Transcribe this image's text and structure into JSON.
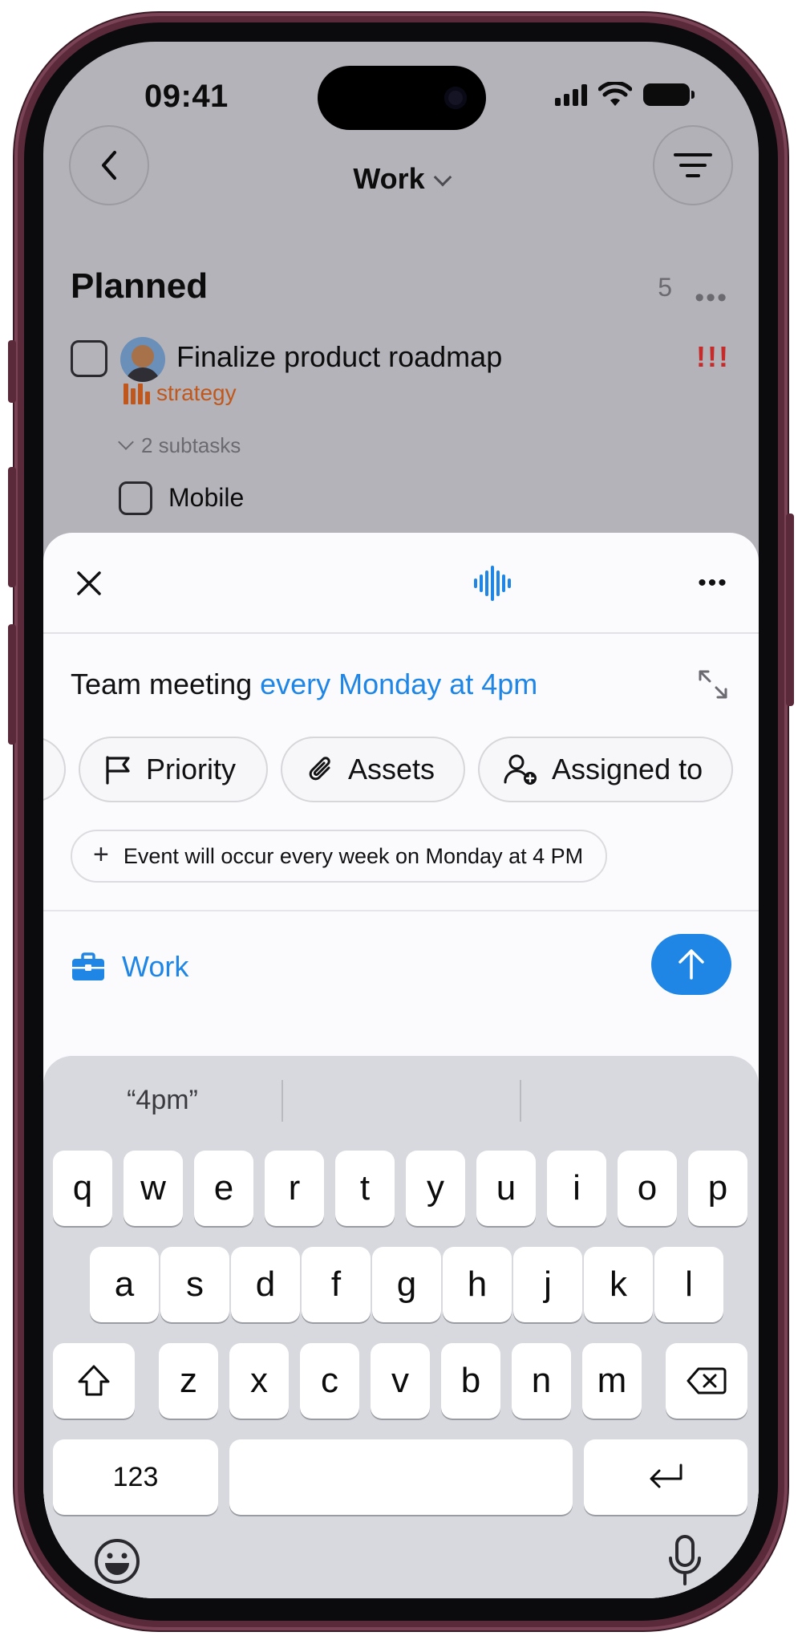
{
  "status_bar": {
    "time": "09:41"
  },
  "nav": {
    "title": "Work"
  },
  "list": {
    "section_title": "Planned",
    "count": "5",
    "task": {
      "title": "Finalize product roadmap",
      "priority": "!!!",
      "tag": "strategy",
      "subtasks_label": "2 subtasks",
      "subtask_title": "Mobile"
    }
  },
  "composer": {
    "text_plain": "Team meeting ",
    "text_highlight": "every Monday at 4pm",
    "chips": [
      {
        "label": "Priority",
        "icon": "flag-icon"
      },
      {
        "label": "Assets",
        "icon": "paperclip-icon"
      },
      {
        "label": "Assigned to",
        "icon": "add-person-icon"
      }
    ],
    "suggestion": "Event will occur every week on Monday at 4 PM",
    "project": "Work"
  },
  "keyboard": {
    "predictions": [
      "“4pm”",
      "",
      ""
    ],
    "rows": [
      [
        "q",
        "w",
        "e",
        "r",
        "t",
        "y",
        "u",
        "i",
        "o",
        "p"
      ],
      [
        "a",
        "s",
        "d",
        "f",
        "g",
        "h",
        "j",
        "k",
        "l"
      ],
      [
        "z",
        "x",
        "c",
        "v",
        "b",
        "n",
        "m"
      ]
    ],
    "numbers_key": "123"
  },
  "colors": {
    "accent": "#1f86e6",
    "priority": "#c62b2b",
    "tag": "#c0581d",
    "frame": "#5a2a3a"
  }
}
